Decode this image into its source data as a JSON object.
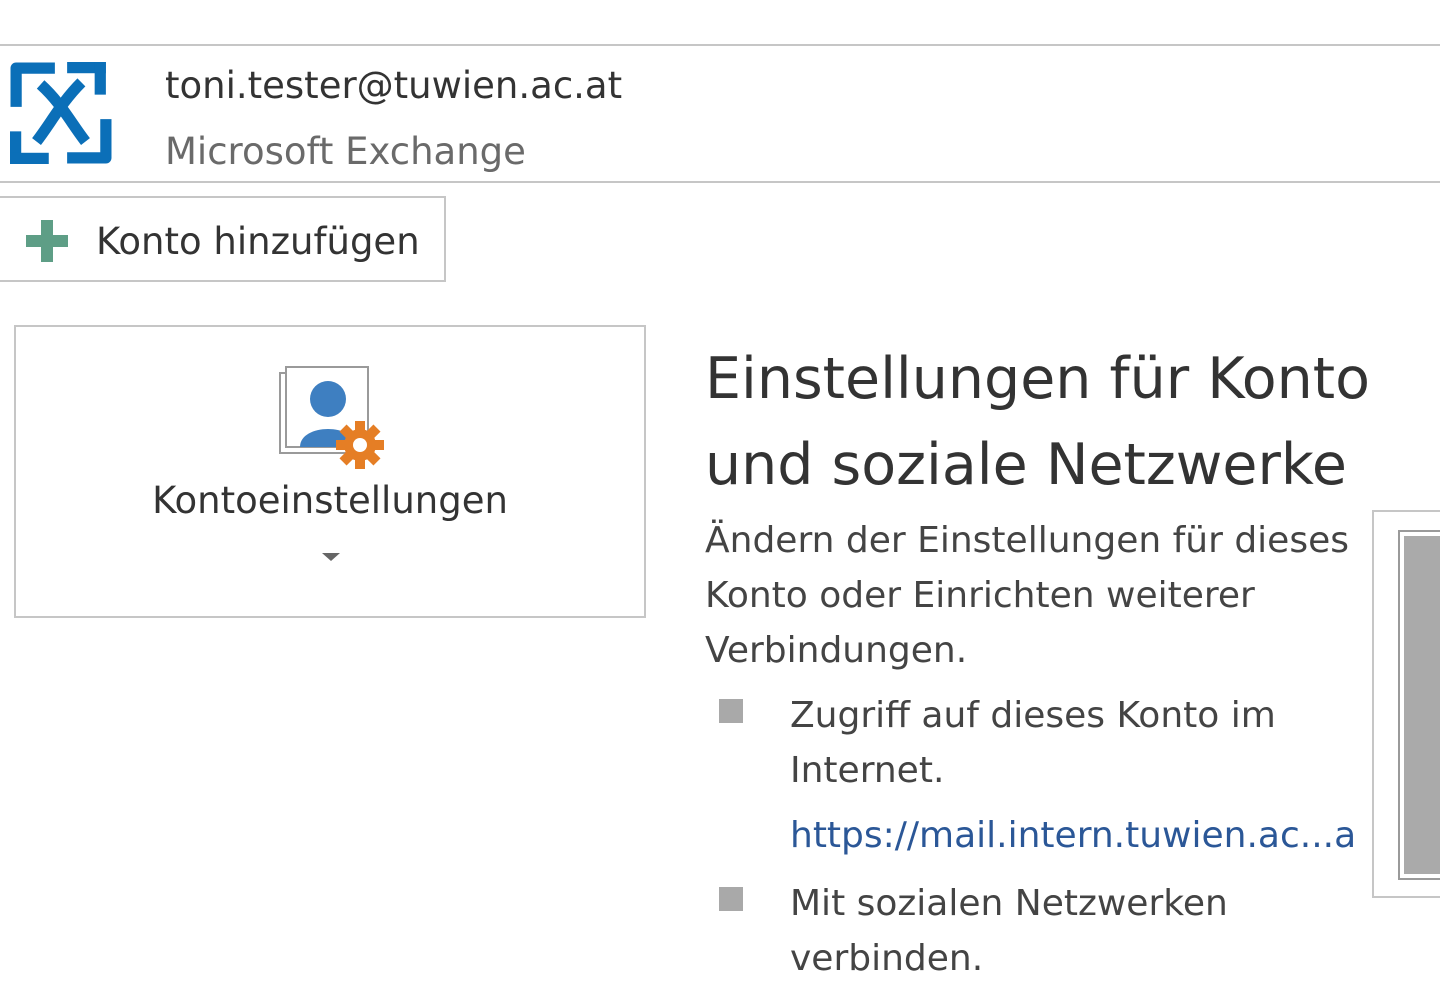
{
  "account": {
    "email": "toni.tester@tuwien.ac.at",
    "type": "Microsoft Exchange",
    "logo_icon": "exchange-logo-icon"
  },
  "toolbar": {
    "add_account_label": "Konto hinzufügen",
    "add_account_icon": "plus-icon"
  },
  "account_settings": {
    "label": "Kontoeinstellungen",
    "icon": "account-settings-icon"
  },
  "section": {
    "heading": "Einstellungen für Konto und soziale Netzwerke",
    "description": "Ändern der Einstellungen für dieses Konto oder Einrichten weiterer Verbindungen.",
    "bullets": [
      {
        "text": "Zugriff auf dieses Konto im Internet.",
        "link": "https://mail.intern.tuwien.ac...a"
      },
      {
        "text": "Mit sozialen Netzwerken verbinden."
      }
    ]
  },
  "colors": {
    "exchange_blue": "#0b6fb8",
    "plus_green": "#5e9e86",
    "gear_orange": "#e57e25",
    "link_blue": "#2b5797",
    "border_gray": "#c6c6c6"
  }
}
